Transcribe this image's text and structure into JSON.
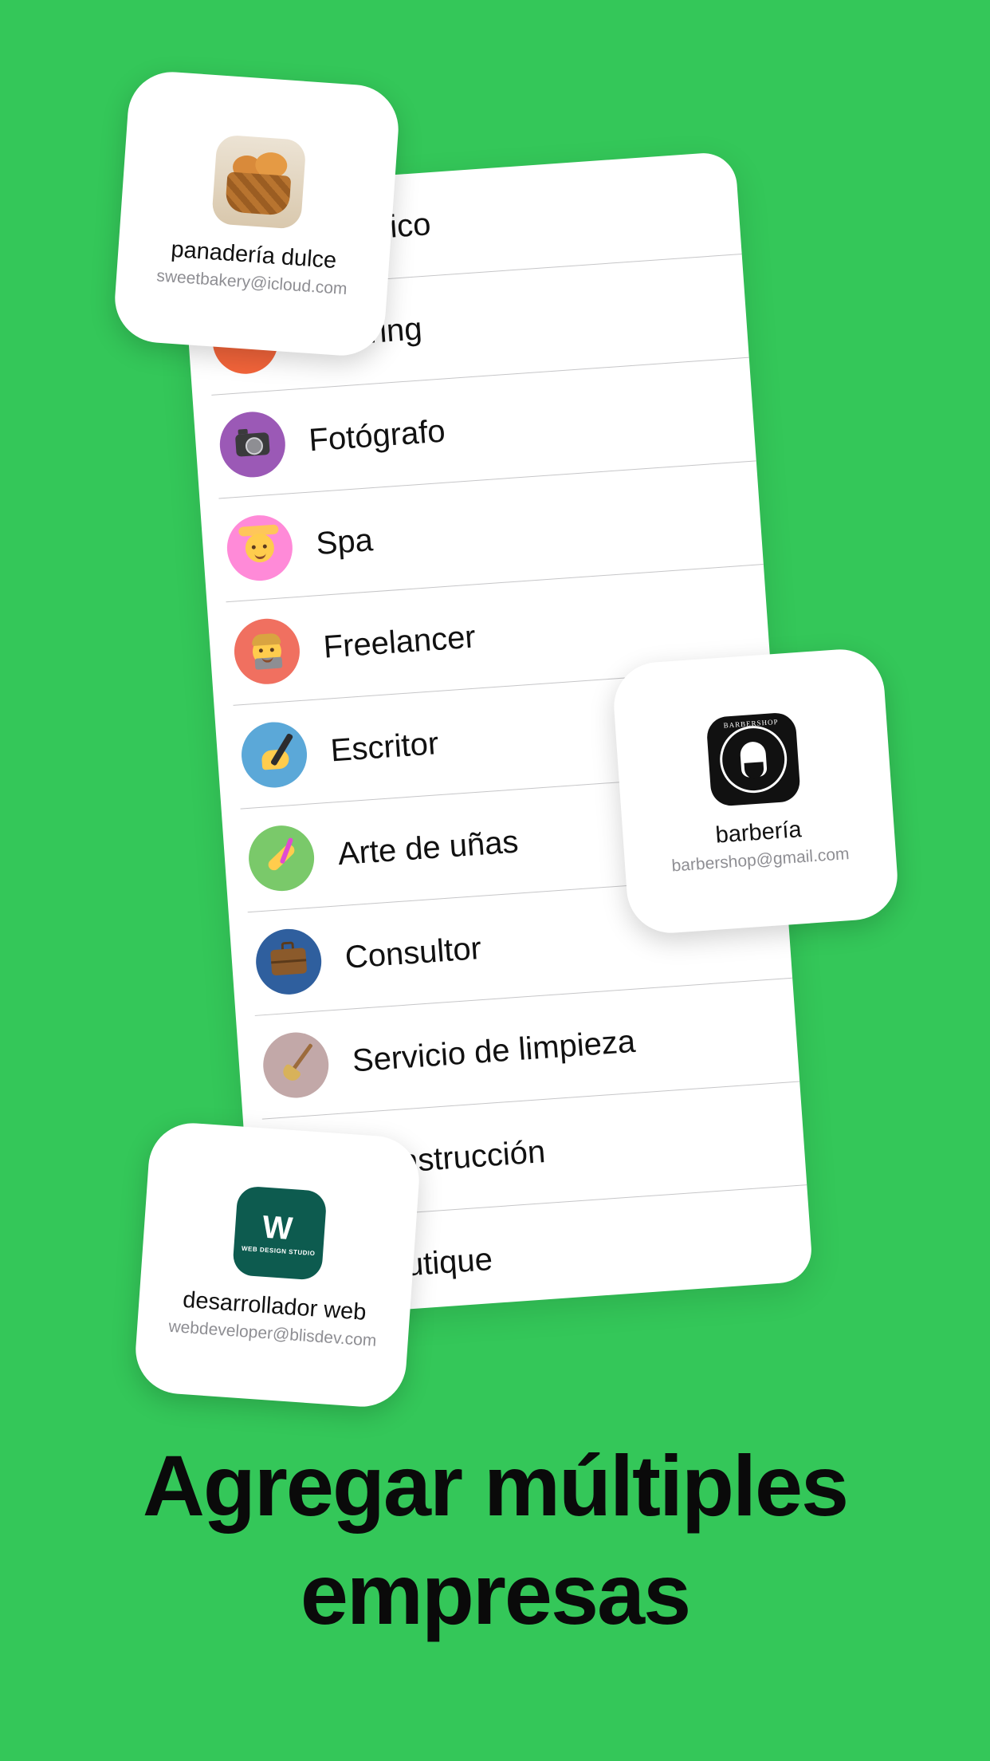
{
  "list": {
    "items": [
      {
        "label": "Mecánico",
        "icon": "wrench-icon",
        "color": "#8e8e93"
      },
      {
        "label": "Catering",
        "icon": "catering-icon",
        "color": "#f2643a"
      },
      {
        "label": "Fotógrafo",
        "icon": "camera-icon",
        "color": "#9b59b6"
      },
      {
        "label": "Spa",
        "icon": "spa-face-icon",
        "color": "#ff8ad8"
      },
      {
        "label": "Freelancer",
        "icon": "freelancer-laptop-icon",
        "color": "#f07060"
      },
      {
        "label": "Escritor",
        "icon": "writing-hand-icon",
        "color": "#5ba8d8"
      },
      {
        "label": "Arte de uñas",
        "icon": "nail-polish-icon",
        "color": "#7ac96a"
      },
      {
        "label": "Consultor",
        "icon": "briefcase-icon",
        "color": "#2f5f9e"
      },
      {
        "label": "Servicio de limpieza",
        "icon": "broom-icon",
        "color": "#c2a8a8"
      },
      {
        "label": "Construcción",
        "icon": "construction-icon",
        "color": "#f07a5a"
      },
      {
        "label": "Boutique",
        "icon": "boutique-icon",
        "color": "#c77dd8"
      }
    ]
  },
  "cards": {
    "bakery": {
      "name": "panadería dulce",
      "email": "sweetbakery@icloud.com",
      "logo": "bread-basket-icon"
    },
    "barber": {
      "name": "barbería",
      "email": "barbershop@gmail.com",
      "logo": "barbershop-logo-icon",
      "logo_text": "BARBERSHOP"
    },
    "web": {
      "name": "desarrollador web",
      "email": "webdeveloper@blisdev.com",
      "logo": "web-design-studio-logo-icon",
      "logo_text": "WEB DESIGN STUDIO"
    }
  },
  "headline": {
    "line1": "Agregar múltiples",
    "line2": "empresas"
  },
  "colors": {
    "background": "#34c759",
    "card": "#ffffff",
    "text": "#111111",
    "secondary_text": "#8e8e93"
  }
}
